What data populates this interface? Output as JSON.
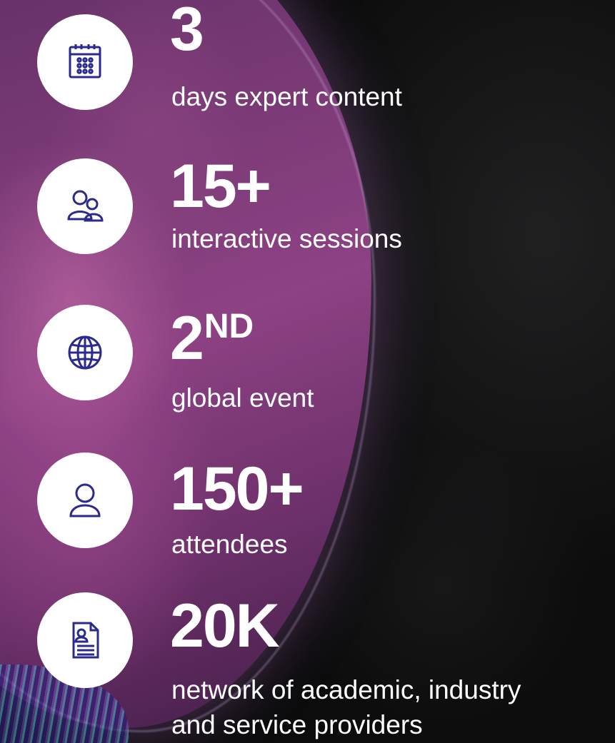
{
  "stats": [
    {
      "value": "3",
      "label": "days expert content",
      "icon": "calendar-icon"
    },
    {
      "value": "15+",
      "label": "interactive sessions",
      "icon": "people-icon"
    },
    {
      "value": "2",
      "suffix": "ND",
      "label": "global event",
      "icon": "globe-icon"
    },
    {
      "value": "150+",
      "label": "attendees",
      "icon": "user-icon"
    },
    {
      "value": "20K",
      "label": "network of academic, industry",
      "label2": "and service providers",
      "icon": "id-card-icon"
    }
  ],
  "colors": {
    "icon_stroke": "#2a2a8f",
    "text": "#ffffff",
    "icon_bg": "#ffffff"
  }
}
